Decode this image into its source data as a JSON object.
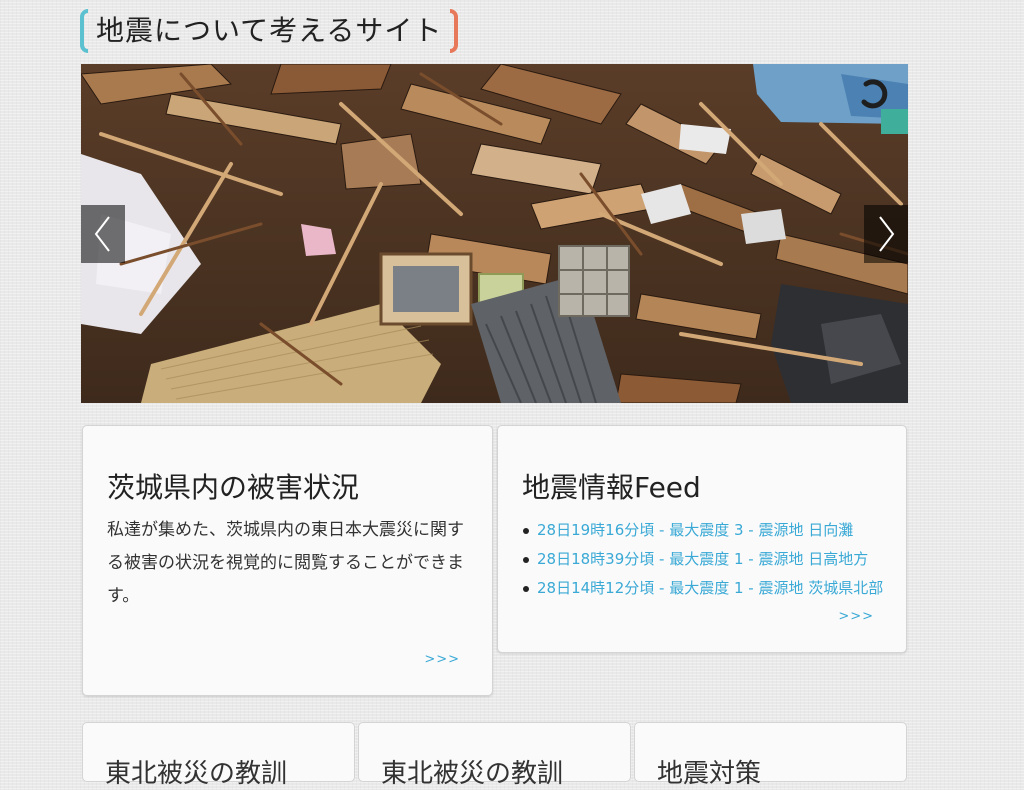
{
  "site": {
    "title": "地震について考えるサイト",
    "accent_left": "#5bc0d0",
    "accent_right": "#e8785a"
  },
  "slider": {
    "image_description_icon": "rubble-photo",
    "prev_icon": "chevron-left-icon",
    "next_icon": "chevron-right-icon",
    "loading_icon": "spinner-icon"
  },
  "cards": {
    "damage": {
      "title": "茨城県内の被害状況",
      "description": "私達が集めた、茨城県内の東日本大震災に関する被害の状況を視覚的に閲覧することができます。",
      "more_label": ">>>"
    },
    "feed": {
      "title": "地震情報Feed",
      "items": [
        "28日19時16分頃 - 最大震度 3 - 震源地 日向灘",
        "28日18時39分頃 - 最大震度 1 - 震源地 日高地方",
        "28日14時12分頃 - 最大震度 1 - 震源地 茨城県北部"
      ],
      "more_label": ">>>"
    }
  },
  "bottom_cards": [
    {
      "title": "東北被災の教訓"
    },
    {
      "title": "東北被災の教訓"
    },
    {
      "title": "地震対策"
    }
  ],
  "colors": {
    "link": "#3aa9d6",
    "card_bg": "#fafafa",
    "page_bg": "#e9e9e9"
  }
}
